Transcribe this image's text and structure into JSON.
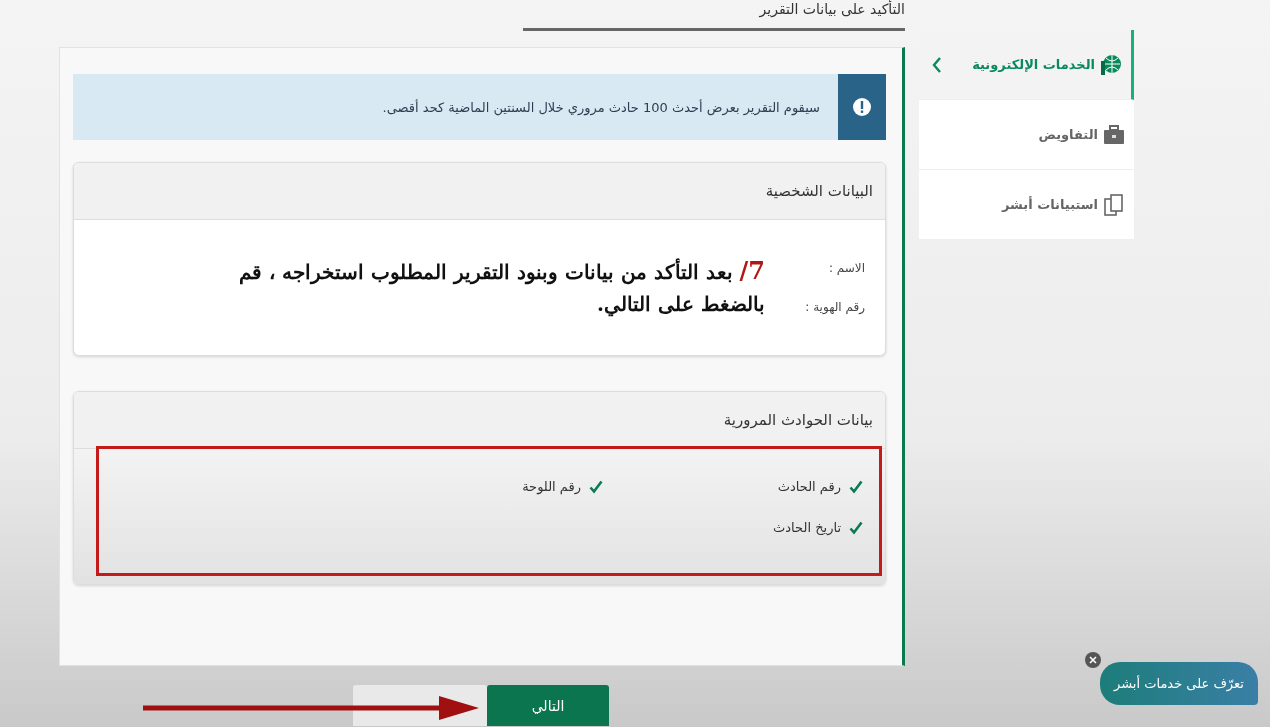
{
  "page_title": "التأكيد على بيانات التقرير",
  "sidebar": {
    "items": [
      {
        "label": "الخدمات الإلكترونية",
        "kind": "globe",
        "selected": true
      },
      {
        "label": "التفاويض",
        "kind": "briefcase",
        "selected": false
      },
      {
        "label": "استبيانات أبشر",
        "kind": "documents",
        "selected": false
      }
    ]
  },
  "alert": {
    "text": "سيقوم التقرير بعرض أحدث 100 حادث مروري خلال السنتين الماضية كحد أقصى."
  },
  "personal_data": {
    "title": "البيانات الشخصية",
    "fields": [
      {
        "label": "الاسم :"
      },
      {
        "label": "رقم الهوية :"
      }
    ]
  },
  "annotation": {
    "step": "7/",
    "text": "بعد التأكد من بيانات وبنود التقرير المطلوب استخراجه ، قم بالضغط على التالي."
  },
  "accident_data": {
    "title": "بيانات الحوادث المرورية",
    "items": [
      {
        "label": "رقم الحادث",
        "checked": true
      },
      {
        "label": "رقم اللوحة",
        "checked": true
      },
      {
        "label": "تاريخ الحادث",
        "checked": true
      }
    ]
  },
  "buttons": {
    "next": "التالي"
  },
  "chat_bubble": {
    "text": "تعرّف على خدمات أبشر"
  }
}
